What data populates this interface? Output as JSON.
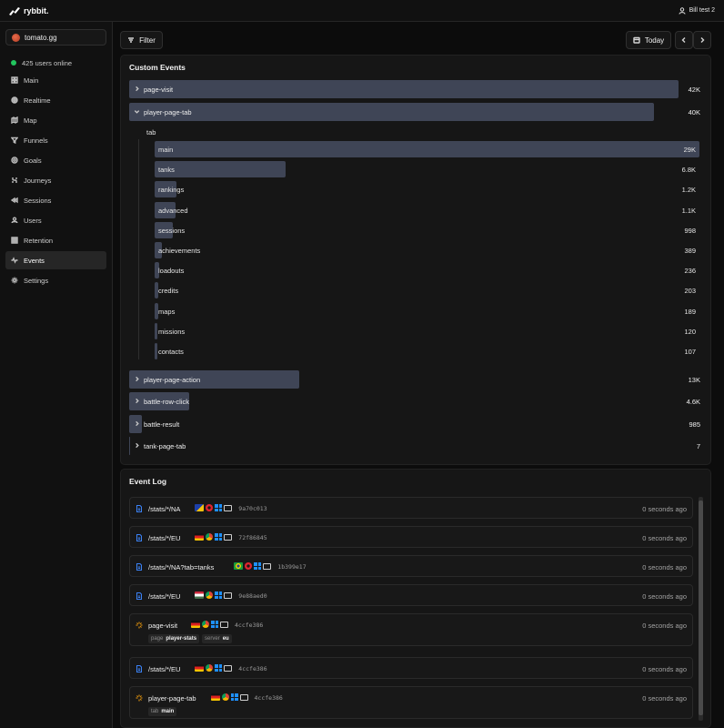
{
  "app": {
    "brand": "rybbit.",
    "user": "Bill test 2"
  },
  "sidebar": {
    "site": "tomato.gg",
    "online": "425 users online",
    "items": [
      {
        "label": "Main",
        "icon": "grid-icon"
      },
      {
        "label": "Realtime",
        "icon": "globe-icon"
      },
      {
        "label": "Map",
        "icon": "map-icon"
      },
      {
        "label": "Funnels",
        "icon": "funnel-icon"
      },
      {
        "label": "Goals",
        "icon": "target-icon"
      },
      {
        "label": "Journeys",
        "icon": "route-icon"
      },
      {
        "label": "Sessions",
        "icon": "rewind-icon"
      },
      {
        "label": "Users",
        "icon": "user-icon"
      },
      {
        "label": "Retention",
        "icon": "retention-icon"
      },
      {
        "label": "Events",
        "icon": "activity-icon",
        "active": true
      },
      {
        "label": "Settings",
        "icon": "gear-icon"
      }
    ]
  },
  "toolbar": {
    "filter": "Filter",
    "today": "Today"
  },
  "custom_events": {
    "title": "Custom Events",
    "rows": [
      {
        "label": "page-visit",
        "value": "42K",
        "fraction": 1.0
      },
      {
        "label": "player-page-tab",
        "value": "40K",
        "fraction": 0.955,
        "expanded": true
      }
    ],
    "group_label": "tab",
    "sub_rows": [
      {
        "label": "main",
        "value": "29K",
        "fraction": 1.0
      },
      {
        "label": "tanks",
        "value": "6.8K",
        "fraction": 0.24
      },
      {
        "label": "rankings",
        "value": "1.2K",
        "fraction": 0.04
      },
      {
        "label": "advanced",
        "value": "1.1K",
        "fraction": 0.038
      },
      {
        "label": "sessions",
        "value": "998",
        "fraction": 0.034
      },
      {
        "label": "achievements",
        "value": "389",
        "fraction": 0.013
      },
      {
        "label": "loadouts",
        "value": "236",
        "fraction": 0.008
      },
      {
        "label": "credits",
        "value": "203",
        "fraction": 0.007
      },
      {
        "label": "maps",
        "value": "189",
        "fraction": 0.0065
      },
      {
        "label": "missions",
        "value": "120",
        "fraction": 0.004
      },
      {
        "label": "contacts",
        "value": "107",
        "fraction": 0.0037
      }
    ],
    "rows_after": [
      {
        "label": "player-page-action",
        "value": "13K",
        "fraction": 0.31
      },
      {
        "label": "battle-row-click",
        "value": "4.6K",
        "fraction": 0.11
      },
      {
        "label": "battle-result",
        "value": "985",
        "fraction": 0.023
      },
      {
        "label": "tank-page-tab",
        "value": "7",
        "fraction": 0.0002
      }
    ]
  },
  "event_log": {
    "title": "Event Log",
    "items": [
      {
        "type": "pageview",
        "path": "/stats/*/NA",
        "flag": "ba",
        "browser": "opera",
        "id": "9a70c013",
        "time": "0 seconds ago"
      },
      {
        "type": "pageview",
        "path": "/stats/*/EU",
        "flag": "de",
        "browser": "chrome",
        "id": "72f86845",
        "time": "0 seconds ago"
      },
      {
        "type": "pageview",
        "path": "/stats/*/NA?tab=tanks",
        "flag": "br",
        "browser": "opera",
        "id": "1b399e17",
        "time": "0 seconds ago"
      },
      {
        "type": "pageview",
        "path": "/stats/*/EU",
        "flag": "hu",
        "browser": "chrome",
        "id": "9e88aed0",
        "time": "0 seconds ago"
      },
      {
        "type": "event",
        "path": "page-visit",
        "flag": "de",
        "browser": "chrome",
        "id": "4ccfe386",
        "time": "0 seconds ago",
        "props": [
          {
            "k": "page",
            "v": "player-stats"
          },
          {
            "k": "server",
            "v": "eu"
          }
        ]
      },
      {
        "type": "pageview",
        "path": "/stats/*/EU",
        "flag": "de",
        "browser": "chrome",
        "id": "4ccfe386",
        "time": "0 seconds ago"
      },
      {
        "type": "event",
        "path": "player-page-tab",
        "flag": "de",
        "browser": "chrome",
        "id": "4ccfe386",
        "time": "0 seconds ago",
        "props": [
          {
            "k": "tab",
            "v": "main"
          }
        ]
      }
    ]
  },
  "colors": {
    "bar": "#3f4556",
    "online": "#22c55e",
    "pageview_icon": "#3b82f6",
    "event_icon": "#f59e0b"
  }
}
